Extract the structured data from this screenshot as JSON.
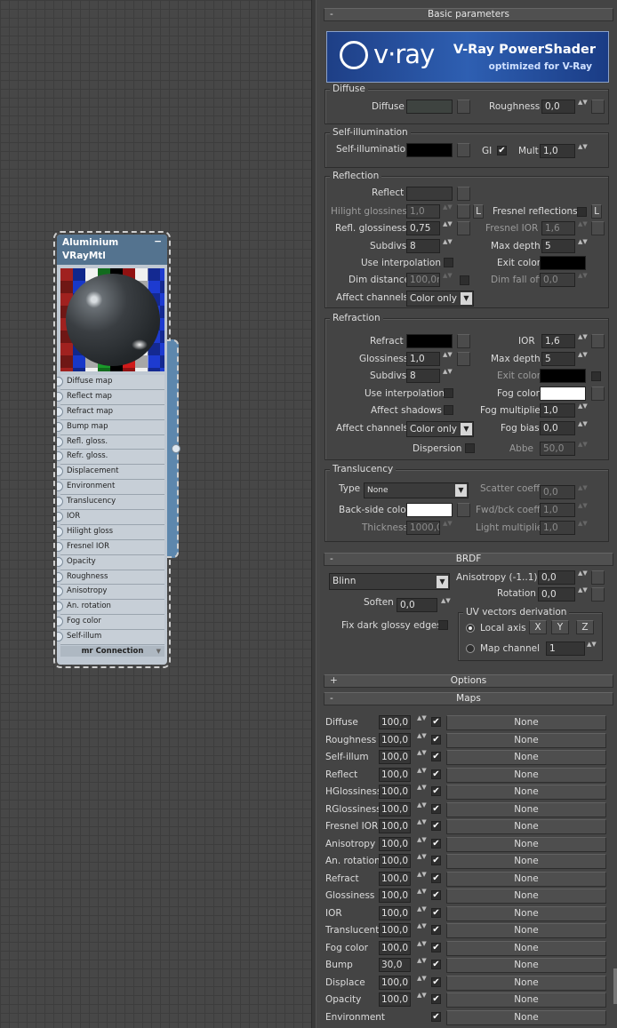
{
  "node": {
    "title_line1": "Aluminium",
    "title_line2": "VRayMtl",
    "minimize": "−",
    "slots": [
      "Diffuse map",
      "Reflect map",
      "Refract map",
      "Bump map",
      "Refl. gloss.",
      "Refr. gloss.",
      "Displacement",
      "Environment",
      "Translucency",
      "IOR",
      "Hilight gloss",
      "Fresnel IOR",
      "Opacity",
      "Roughness",
      "Anisotropy",
      "An. rotation",
      "Fog color",
      "Self-illum"
    ],
    "mr_connection": "mr Connection"
  },
  "basic": {
    "title": "Basic parameters",
    "toggle": "-",
    "logo": {
      "brand": "v·ray",
      "product": "V-Ray PowerShader",
      "tagline": "optimized for V-Ray"
    },
    "diffuse": {
      "group": "Diffuse",
      "label": "Diffuse",
      "roughness_label": "Roughness",
      "roughness": "0,0",
      "color": "#3e4340"
    },
    "selfillum": {
      "group": "Self-illumination",
      "label": "Self-illumination",
      "gi_label": "GI",
      "mult_label": "Mult",
      "mult": "1,0",
      "color": "#000000"
    },
    "reflection": {
      "group": "Reflection",
      "reflect": "Reflect",
      "reflect_color": "#3a3a3a",
      "hilight": "Hilight glossiness",
      "hilight_val": "1,0",
      "lock": "L",
      "fresnel": "Fresnel reflections",
      "fresnel_lock": "L",
      "refl_gloss": "Refl. glossiness",
      "refl_gloss_val": "0,75",
      "fresnel_ior": "Fresnel IOR",
      "fresnel_ior_val": "1,6",
      "subdivs": "Subdivs",
      "subdivs_val": "8",
      "max_depth": "Max depth",
      "max_depth_val": "5",
      "use_interp": "Use interpolation",
      "exit_color": "Exit color",
      "exit_color_val": "#000000",
      "dim_distance": "Dim distance",
      "dim_distance_val": "100,0m",
      "dim_falloff": "Dim fall off",
      "dim_falloff_val": "0,0",
      "affect": "Affect channels",
      "affect_val": "Color only"
    },
    "refraction": {
      "group": "Refraction",
      "refract": "Refract",
      "refract_color": "#000000",
      "ior": "IOR",
      "ior_val": "1,6",
      "gloss": "Glossiness",
      "gloss_val": "1,0",
      "max_depth": "Max depth",
      "max_depth_val": "5",
      "subdivs": "Subdivs",
      "subdivs_val": "8",
      "exit_color": "Exit color",
      "exit_color_val": "#000000",
      "use_interp": "Use interpolation",
      "fog_color": "Fog color",
      "fog_color_val": "#ffffff",
      "affect_shadows": "Affect shadows",
      "fog_mult": "Fog multiplier",
      "fog_mult_val": "1,0",
      "affect": "Affect channels",
      "affect_val": "Color only",
      "fog_bias": "Fog bias",
      "fog_bias_val": "0,0",
      "dispersion": "Dispersion",
      "abbe": "Abbe",
      "abbe_val": "50,0"
    },
    "translucency": {
      "group": "Translucency",
      "type": "Type",
      "type_val": "None",
      "scatter": "Scatter coeff",
      "scatter_val": "0,0",
      "backside": "Back-side color",
      "backside_color": "#ffffff",
      "fwdbck": "Fwd/bck coeff",
      "fwdbck_val": "1,0",
      "thickness": "Thickness",
      "thickness_val": "1000,0",
      "light_mult": "Light multiplier",
      "light_mult_val": "1,0"
    }
  },
  "brdf": {
    "title": "BRDF",
    "toggle": "-",
    "type_val": "Blinn",
    "aniso": "Anisotropy (-1..1)",
    "aniso_val": "0,0",
    "rotation": "Rotation",
    "rotation_val": "0,0",
    "soften": "Soften",
    "soften_val": "0,0",
    "fix_dark": "Fix dark glossy edges",
    "uv_group": "UV vectors derivation",
    "local_axis": "Local axis",
    "x": "X",
    "y": "Y",
    "z": "Z",
    "map_channel": "Map channel",
    "map_channel_val": "1"
  },
  "options": {
    "title": "Options",
    "toggle": "+"
  },
  "maps": {
    "title": "Maps",
    "toggle": "-",
    "rows": [
      {
        "label": "Diffuse",
        "value": "100,0",
        "map": "None"
      },
      {
        "label": "Roughness",
        "value": "100,0",
        "map": "None"
      },
      {
        "label": "Self-illum",
        "value": "100,0",
        "map": "None"
      },
      {
        "label": "Reflect",
        "value": "100,0",
        "map": "None"
      },
      {
        "label": "HGlossiness",
        "value": "100,0",
        "map": "None"
      },
      {
        "label": "RGlossiness",
        "value": "100,0",
        "map": "None"
      },
      {
        "label": "Fresnel IOR",
        "value": "100,0",
        "map": "None"
      },
      {
        "label": "Anisotropy",
        "value": "100,0",
        "map": "None"
      },
      {
        "label": "An. rotation",
        "value": "100,0",
        "map": "None"
      },
      {
        "label": "Refract",
        "value": "100,0",
        "map": "None"
      },
      {
        "label": "Glossiness",
        "value": "100,0",
        "map": "None"
      },
      {
        "label": "IOR",
        "value": "100,0",
        "map": "None"
      },
      {
        "label": "Translucent",
        "value": "100,0",
        "map": "None"
      },
      {
        "label": "Fog color",
        "value": "100,0",
        "map": "None"
      },
      {
        "label": "Bump",
        "value": "30,0",
        "map": "None"
      },
      {
        "label": "Displace",
        "value": "100,0",
        "map": "None"
      },
      {
        "label": "Opacity",
        "value": "100,0",
        "map": "None"
      },
      {
        "label": "Environment",
        "value": "",
        "map": "None"
      }
    ]
  },
  "icons": {
    "check": "✔",
    "spinner": "▲▼",
    "dropdown": "▼"
  }
}
